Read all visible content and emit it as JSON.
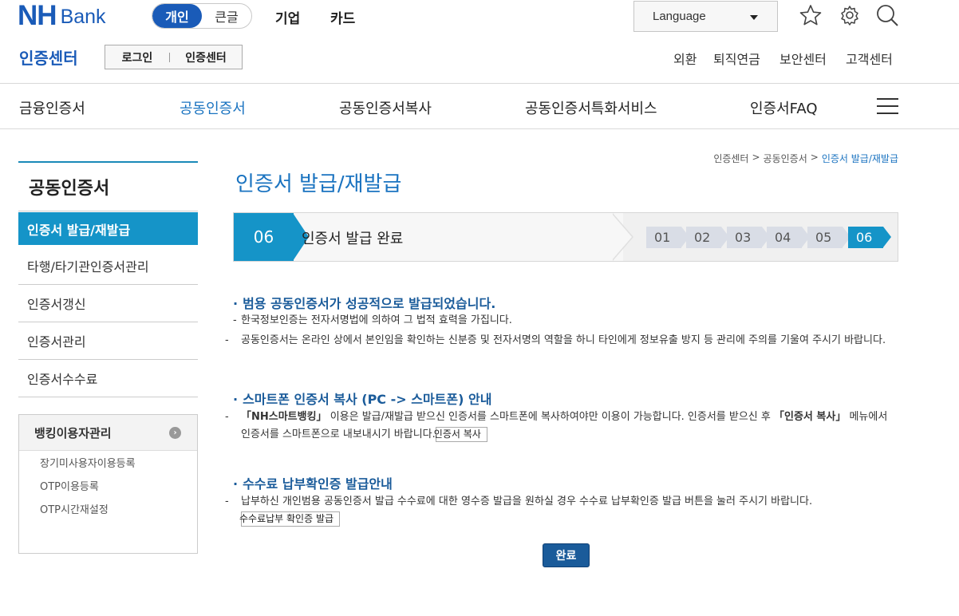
{
  "brand": {
    "logo_nh": "NH",
    "logo_bank": "Bank"
  },
  "segment": {
    "active": "개인",
    "inactive": "큰글"
  },
  "top_menu": [
    "기업",
    "카드"
  ],
  "language": {
    "label": "Language"
  },
  "icons": {
    "favorite": "star-icon",
    "settings": "gear-icon",
    "search": "search-icon",
    "menu": "hamburger-icon"
  },
  "cert_center": {
    "title": "인증센터",
    "login": "로그인",
    "center": "인증센터"
  },
  "util_links": [
    "외환",
    "퇴직연금",
    "보안센터",
    "고객센터"
  ],
  "gnb": [
    "금융인증서",
    "공동인증서",
    "공동인증서복사",
    "공동인증서특화서비스",
    "인증서FAQ"
  ],
  "lnb": {
    "title": "공동인증서",
    "items": [
      "인증서 발급/재발급",
      "타행/타기관인증서관리",
      "인증서갱신",
      "인증서관리",
      "인증서수수료"
    ],
    "box_title": "뱅킹이용자관리",
    "box_items": [
      "장기미사용자이용등록",
      "OTP이용등록",
      "OTP시간재설정"
    ]
  },
  "breadcrumb": [
    "인증센터",
    "공동인증서",
    "인증서 발급/재발급"
  ],
  "page_title": "인증서 발급/재발급",
  "steps": {
    "current_num": "06",
    "current_label": "인증서 발급 완료",
    "all": [
      "01",
      "02",
      "03",
      "04",
      "05",
      "06"
    ],
    "active_index": 5
  },
  "sections": [
    {
      "title": "범용 공동인증서가 성공적으로 발급되었습니다.",
      "lines": [
        "한국정보인증는 전자서명법에 의하여 그 법적 효력을 가집니다.",
        "공동인증서는 온라인 상에서 본인임을 확인하는 신분증 및 전자서명의 역할을 하니 타인에게 정보유출 방지 등 관리에 주의를 기울여 주시기 바랍니다."
      ]
    },
    {
      "title": "스마트폰 인증서 복사 (PC -> 스마트폰) 안내",
      "line_a": "「NH스마트뱅킹」",
      "line_b": "이용은 발급/재발급 받으신 인증서를 스마트폰에 복사하여야만 이용이 가능합니다. 인증서를 받으신 후",
      "line_c": "「인증서 복사」",
      "line_d": "메뉴에서 인증서를 스마트폰으로 내보내시기 바랍니다.",
      "button": "인증서 복사"
    },
    {
      "title": "수수료 납부확인증 발급안내",
      "line": "납부하신 개인범용 공동인증서 발급 수수료에 대한 영수증 발급을 원하실 경우 수수료 납부확인증 발급 버튼을 눌러 주시기 바랍니다.",
      "button": "수수료납부 확인증 발급"
    }
  ],
  "complete_button": "완료"
}
